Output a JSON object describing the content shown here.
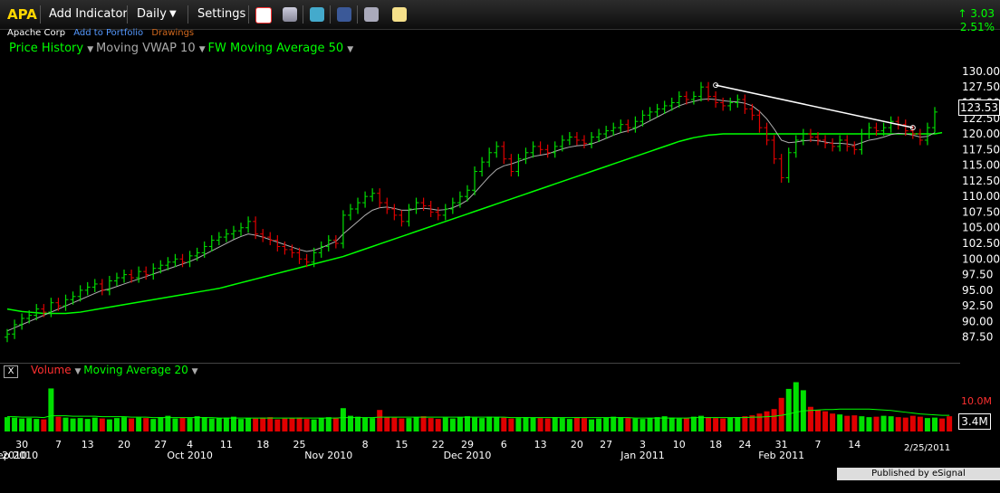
{
  "toolbar": {
    "ticker": "APA",
    "add_indicator": "Add Indicator",
    "interval": "Daily",
    "settings": "Settings"
  },
  "subrow": {
    "company": "Apache Corp",
    "add_portfolio": "Add to Portfolio",
    "drawings": "Drawings"
  },
  "indicators": {
    "price_history": "Price History",
    "vwap": "Moving VWAP 10",
    "ma": "FW Moving Average 50"
  },
  "change": {
    "points": "3.03",
    "percent": "2.51%"
  },
  "last_price": "123.53",
  "volume_panel": {
    "close": "X",
    "volume": "Volume",
    "ma": "Moving Average 20"
  },
  "volume_axis": {
    "label_high": "10.0M",
    "label_current": "3.4M"
  },
  "date_stamp": "2/25/2011",
  "published": "Published by eSignal (www.esignal.com)",
  "colors": {
    "up": "#00e000",
    "down": "#e00000",
    "ma": "#00ff00",
    "vwap": "#b0b0b0",
    "trend": "#ffffff"
  },
  "chart_data": {
    "type": "candlestick",
    "ylim": [
      85,
      131
    ],
    "y_ticks": [
      "130.00",
      "127.50",
      "125.00",
      "122.50",
      "120.00",
      "117.50",
      "115.00",
      "112.50",
      "110.00",
      "107.50",
      "105.00",
      "102.50",
      "100.00",
      "97.50",
      "95.00",
      "92.50",
      "90.00",
      "87.50"
    ],
    "x_ticks": [
      {
        "i": 2,
        "label": "30"
      },
      {
        "i": 1,
        "label": "2010"
      },
      {
        "i": 1,
        "label": "Sep 2010"
      },
      {
        "i": 7,
        "label": "7"
      },
      {
        "i": 11,
        "label": "13"
      },
      {
        "i": 16,
        "label": "20"
      },
      {
        "i": 21,
        "label": "27"
      },
      {
        "i": 25,
        "label": "4"
      },
      {
        "i": 25,
        "label": "Oct 2010"
      },
      {
        "i": 30,
        "label": "11"
      },
      {
        "i": 35,
        "label": "18"
      },
      {
        "i": 40,
        "label": "25"
      },
      {
        "i": 44,
        "label": "Nov 2010"
      },
      {
        "i": 49,
        "label": "8"
      },
      {
        "i": 54,
        "label": "15"
      },
      {
        "i": 59,
        "label": "22"
      },
      {
        "i": 63,
        "label": "29"
      },
      {
        "i": 63,
        "label": "Dec 2010"
      },
      {
        "i": 68,
        "label": "6"
      },
      {
        "i": 73,
        "label": "13"
      },
      {
        "i": 78,
        "label": "20"
      },
      {
        "i": 82,
        "label": "27"
      },
      {
        "i": 87,
        "label": "Jan 2011"
      },
      {
        "i": 87,
        "label": "3"
      },
      {
        "i": 92,
        "label": "10"
      },
      {
        "i": 97,
        "label": "18"
      },
      {
        "i": 101,
        "label": "24"
      },
      {
        "i": 106,
        "label": "31"
      },
      {
        "i": 106,
        "label": "Feb 2011"
      },
      {
        "i": 111,
        "label": "7"
      },
      {
        "i": 116,
        "label": "14"
      }
    ],
    "close": [
      88,
      89.5,
      90.5,
      91,
      92,
      91.5,
      93,
      92.5,
      93.5,
      94,
      95,
      95.5,
      96,
      95,
      96.5,
      97,
      97.5,
      97,
      98,
      97.5,
      98.5,
      99,
      99.5,
      100,
      99.5,
      100.5,
      101,
      102,
      103,
      103.5,
      104,
      104.5,
      105,
      106,
      104,
      103.5,
      103,
      102,
      101.5,
      101,
      100,
      99.5,
      101,
      102,
      103,
      102.5,
      107,
      108,
      109,
      110,
      110.5,
      109,
      108,
      107,
      106,
      108,
      109,
      108.5,
      107.5,
      107,
      108,
      109,
      110,
      111,
      114,
      115.5,
      117,
      118,
      116,
      114,
      116,
      117,
      118,
      117.5,
      117,
      118,
      119,
      119.5,
      119,
      118.5,
      119.5,
      120,
      120.5,
      121,
      121.5,
      121,
      122,
      123,
      123.5,
      124,
      124.5,
      125,
      126,
      125.5,
      126,
      127.5,
      126,
      125,
      124.5,
      125,
      125.5,
      124,
      123,
      121,
      119,
      116,
      113,
      117,
      119,
      120,
      119.5,
      119,
      118.5,
      118,
      119,
      118,
      117.5,
      120,
      121,
      120.5,
      121,
      122,
      121.5,
      120.5,
      120,
      119,
      121,
      123.5
    ],
    "vwap_10": [
      88.5,
      89,
      89.5,
      90,
      90.5,
      91,
      91.5,
      92,
      92.5,
      93,
      93.5,
      94,
      94.5,
      95,
      95.2,
      95.6,
      96,
      96.4,
      96.8,
      97.2,
      97.6,
      98,
      98.4,
      98.8,
      99.2,
      99.6,
      100.1,
      100.7,
      101.3,
      101.9,
      102.5,
      103.1,
      103.6,
      104,
      103.8,
      103.5,
      103.1,
      102.7,
      102.3,
      101.9,
      101.5,
      101.2,
      101.4,
      101.8,
      102.3,
      102.8,
      104,
      105,
      106,
      107,
      107.8,
      108.2,
      108.3,
      108.1,
      107.8,
      107.8,
      108,
      108.1,
      108,
      107.8,
      107.9,
      108.2,
      108.7,
      109.4,
      110.6,
      111.9,
      113.2,
      114.3,
      114.9,
      115.2,
      115.6,
      116,
      116.4,
      116.6,
      116.8,
      117.2,
      117.6,
      117.9,
      118.1,
      118.2,
      118.4,
      118.8,
      119.3,
      119.8,
      120.2,
      120.5,
      120.9,
      121.5,
      122.1,
      122.7,
      123.3,
      123.9,
      124.5,
      124.9,
      125.2,
      125.5,
      125.6,
      125.5,
      125.3,
      125.2,
      125.1,
      124.9,
      124.5,
      123.6,
      122.4,
      120.8,
      119,
      118.6,
      118.7,
      118.9,
      119,
      118.9,
      118.7,
      118.5,
      118.5,
      118.4,
      118.2,
      118.6,
      119,
      119.2,
      119.5,
      119.9,
      120.1,
      120,
      119.8,
      119.5,
      119.6,
      120.2
    ],
    "ma_50": [
      92,
      91.8,
      91.6,
      91.5,
      91.4,
      91.3,
      91.3,
      91.3,
      91.3,
      91.4,
      91.5,
      91.7,
      91.9,
      92.1,
      92.3,
      92.5,
      92.7,
      92.9,
      93.1,
      93.3,
      93.5,
      93.7,
      93.9,
      94.1,
      94.3,
      94.5,
      94.7,
      94.9,
      95.1,
      95.3,
      95.6,
      95.9,
      96.2,
      96.5,
      96.8,
      97.1,
      97.4,
      97.7,
      98,
      98.3,
      98.6,
      98.9,
      99.2,
      99.5,
      99.8,
      100.1,
      100.4,
      100.8,
      101.2,
      101.6,
      102,
      102.4,
      102.8,
      103.2,
      103.6,
      104,
      104.4,
      104.8,
      105.2,
      105.6,
      106,
      106.4,
      106.8,
      107.2,
      107.6,
      108,
      108.4,
      108.8,
      109.2,
      109.6,
      110,
      110.4,
      110.8,
      111.2,
      111.6,
      112,
      112.4,
      112.8,
      113.2,
      113.6,
      114,
      114.4,
      114.8,
      115.2,
      115.6,
      116,
      116.4,
      116.8,
      117.2,
      117.6,
      118,
      118.4,
      118.8,
      119.1,
      119.4,
      119.6,
      119.8,
      119.9,
      120,
      120,
      120,
      120,
      120,
      120,
      120,
      120,
      120,
      120,
      120,
      120,
      120,
      120,
      120,
      120,
      120,
      120,
      120,
      120,
      120,
      120,
      120,
      120,
      120,
      120,
      120,
      120,
      120,
      120,
      120.2
    ],
    "volume": [
      3.2,
      3.1,
      2.9,
      3.0,
      2.8,
      2.7,
      9.6,
      3.3,
      3.1,
      2.9,
      3.0,
      2.8,
      3.1,
      2.9,
      2.7,
      3.0,
      3.2,
      2.9,
      3.1,
      3.0,
      2.8,
      3.2,
      3.5,
      2.9,
      3.1,
      3.0,
      3.4,
      3.2,
      2.9,
      3.0,
      3.1,
      3.3,
      2.8,
      3.0,
      2.9,
      3.1,
      3.2,
      2.7,
      2.9,
      3.0,
      3.1,
      2.8,
      2.7,
      3.0,
      3.2,
      3.1,
      5.2,
      3.5,
      3.3,
      3.1,
      3.0,
      4.8,
      3.2,
      3.1,
      2.9,
      3.0,
      3.2,
      3.4,
      3.0,
      2.8,
      3.1,
      2.9,
      3.2,
      3.4,
      3.1,
      3.0,
      3.3,
      3.2,
      3.1,
      2.9,
      3.0,
      3.2,
      3.1,
      3.0,
      2.9,
      3.2,
      3.0,
      2.8,
      3.1,
      3.0,
      2.7,
      2.9,
      3.1,
      3.3,
      3.2,
      3.0,
      2.9,
      2.8,
      3.0,
      3.2,
      3.4,
      3.1,
      2.9,
      3.0,
      3.3,
      3.5,
      3.2,
      3.0,
      2.9,
      3.1,
      3.2,
      3.4,
      3.6,
      4.0,
      4.5,
      5.0,
      7.5,
      9.5,
      11.0,
      9.2,
      5.5,
      4.8,
      4.5,
      4.0,
      3.8,
      3.5,
      3.6,
      3.4,
      3.2,
      3.3,
      3.5,
      3.4,
      3.2,
      3.1,
      3.5,
      3.3,
      3.0,
      3.1,
      2.9,
      3.4
    ],
    "volume_ma_20": [
      3.3,
      3.3,
      3.2,
      3.2,
      3.2,
      3.1,
      3.5,
      3.5,
      3.5,
      3.4,
      3.4,
      3.4,
      3.4,
      3.3,
      3.3,
      3.3,
      3.3,
      3.2,
      3.2,
      3.2,
      3.1,
      3.1,
      3.1,
      3.1,
      3.1,
      3.1,
      3.1,
      3.1,
      3.1,
      3.0,
      3.0,
      3.0,
      3.0,
      3.0,
      3.0,
      3.0,
      3.0,
      3.0,
      3.0,
      3.0,
      3.0,
      3.0,
      3.0,
      3.0,
      3.0,
      3.0,
      3.1,
      3.1,
      3.1,
      3.1,
      3.1,
      3.2,
      3.2,
      3.2,
      3.2,
      3.2,
      3.2,
      3.2,
      3.2,
      3.2,
      3.2,
      3.2,
      3.2,
      3.2,
      3.2,
      3.2,
      3.2,
      3.2,
      3.2,
      3.1,
      3.1,
      3.1,
      3.1,
      3.1,
      3.1,
      3.1,
      3.1,
      3.1,
      3.1,
      3.1,
      3.1,
      3.1,
      3.1,
      3.1,
      3.1,
      3.1,
      3.0,
      3.0,
      3.0,
      3.0,
      3.0,
      3.0,
      3.0,
      3.0,
      3.1,
      3.1,
      3.1,
      3.1,
      3.1,
      3.1,
      3.1,
      3.1,
      3.2,
      3.2,
      3.3,
      3.4,
      3.6,
      3.9,
      4.3,
      4.6,
      4.7,
      4.8,
      4.9,
      4.9,
      5.0,
      5.0,
      5.0,
      5.0,
      5.0,
      4.9,
      4.8,
      4.7,
      4.5,
      4.3,
      4.1,
      3.9,
      3.8,
      3.7,
      3.6,
      3.6
    ],
    "trendline": [
      {
        "i": 97,
        "price": 127.8
      },
      {
        "i": 124,
        "price": 121.0
      }
    ]
  }
}
